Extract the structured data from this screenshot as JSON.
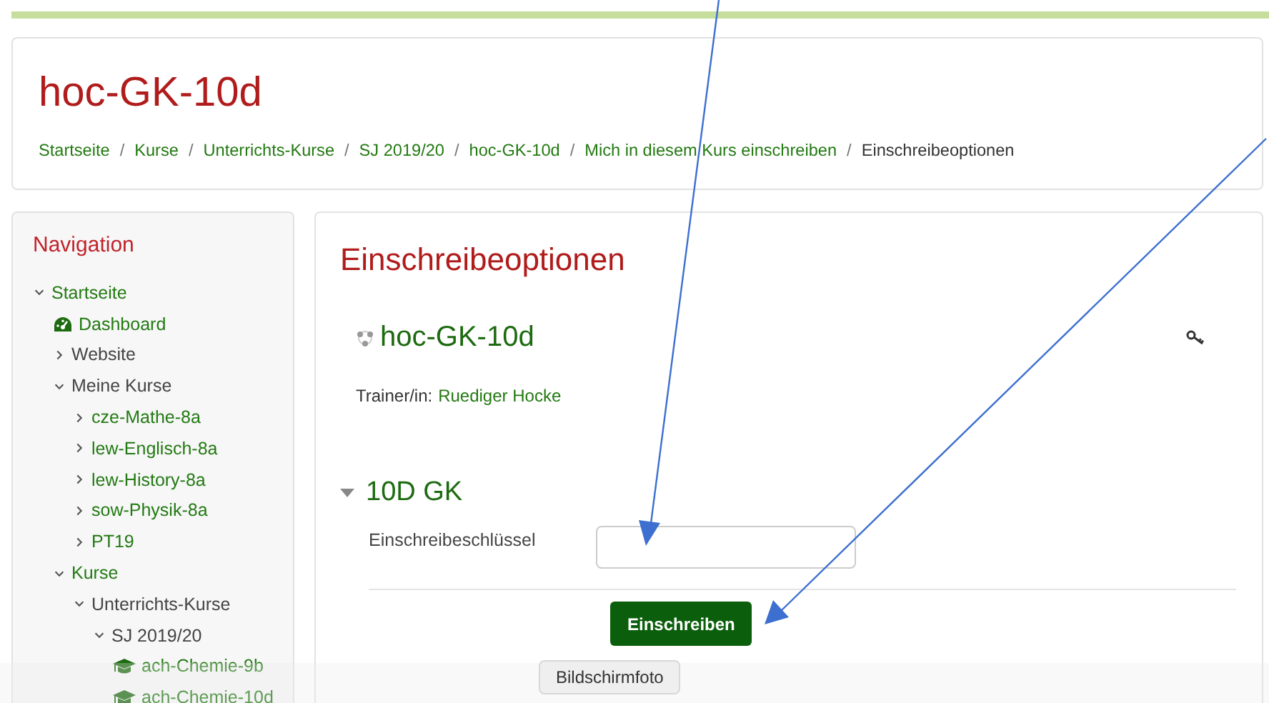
{
  "header": {
    "title": "hoc-GK-10d",
    "separator": "/",
    "breadcrumbs": [
      {
        "label": "Startseite",
        "link": true
      },
      {
        "label": "Kurse",
        "link": true
      },
      {
        "label": "Unterrichts-Kurse",
        "link": true
      },
      {
        "label": "SJ 2019/20",
        "link": true
      },
      {
        "label": "hoc-GK-10d",
        "link": true
      },
      {
        "label": "Mich in diesem Kurs einschreiben",
        "link": true
      },
      {
        "label": "Einschreibeoptionen",
        "link": false
      }
    ]
  },
  "navigation": {
    "title": "Navigation",
    "tree": [
      {
        "label": "Startseite",
        "kind": "branch",
        "link": true,
        "expanded": true,
        "children": [
          {
            "label": "Dashboard",
            "kind": "dashboard",
            "link": true
          },
          {
            "label": "Website",
            "kind": "branch",
            "link": false,
            "expanded": false
          },
          {
            "label": "Meine Kurse",
            "kind": "branch",
            "link": false,
            "expanded": true,
            "children": [
              {
                "label": "cze-Mathe-8a",
                "kind": "branch",
                "link": true,
                "expanded": false
              },
              {
                "label": "lew-Englisch-8a",
                "kind": "branch",
                "link": true,
                "expanded": false
              },
              {
                "label": "lew-History-8a",
                "kind": "branch",
                "link": true,
                "expanded": false
              },
              {
                "label": "sow-Physik-8a",
                "kind": "branch",
                "link": true,
                "expanded": false
              },
              {
                "label": "PT19",
                "kind": "branch",
                "link": true,
                "expanded": false
              }
            ]
          },
          {
            "label": "Kurse",
            "kind": "branch",
            "link": true,
            "expanded": true,
            "children": [
              {
                "label": "Unterrichts-Kurse",
                "kind": "branch",
                "link": false,
                "expanded": true,
                "children": [
                  {
                    "label": "SJ 2019/20",
                    "kind": "branch",
                    "link": false,
                    "expanded": true,
                    "children": [
                      {
                        "label": "ach-Chemie-9b",
                        "kind": "course",
                        "link": true
                      },
                      {
                        "label": "ach-Chemie-10d",
                        "kind": "course",
                        "link": true
                      }
                    ]
                  }
                ]
              }
            ]
          }
        ]
      }
    ]
  },
  "main": {
    "title": "Einschreibeoptionen",
    "course": {
      "name": "hoc-GK-10d",
      "teacher_label": "Trainer/in:",
      "teacher": "Ruediger Hocke"
    },
    "section": {
      "title": "10D GK",
      "expanded": true,
      "field_label": "Einschreibeschlüssel",
      "button": "Einschreiben"
    }
  },
  "tooltip": "Bildschirmfoto"
}
